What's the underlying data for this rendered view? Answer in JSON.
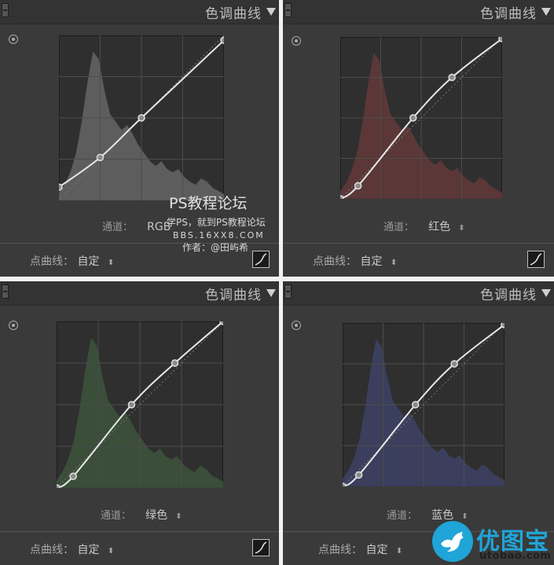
{
  "panels": [
    {
      "title": "色调曲线",
      "channel_label": "通道：",
      "channel": "RGB",
      "point_curve_label": "点曲线：",
      "point_curve_value": "自定",
      "hist_color": "#6e6e6e",
      "curve": [
        [
          0,
          0.08
        ],
        [
          0.25,
          0.26
        ],
        [
          0.5,
          0.5
        ],
        [
          1,
          0.97
        ]
      ]
    },
    {
      "title": "色调曲线",
      "channel_label": "通道：",
      "channel": "红色",
      "point_curve_label": "点曲线：",
      "point_curve_value": "自定",
      "hist_color": "#6b3b3b",
      "curve": [
        [
          0,
          0
        ],
        [
          0.11,
          0.08
        ],
        [
          0.45,
          0.5
        ],
        [
          0.69,
          0.75
        ],
        [
          1,
          0.99
        ]
      ]
    },
    {
      "title": "色调曲线",
      "channel_label": "通道：",
      "channel": "绿色",
      "point_curve_label": "点曲线：",
      "point_curve_value": "自定",
      "hist_color": "#3f5a3f",
      "curve": [
        [
          0,
          0
        ],
        [
          0.1,
          0.07
        ],
        [
          0.45,
          0.5
        ],
        [
          0.71,
          0.75
        ],
        [
          1,
          1
        ]
      ]
    },
    {
      "title": "色调曲线",
      "channel_label": "通道：",
      "channel": "蓝色",
      "point_curve_label": "点曲线：",
      "point_curve_value": "自定",
      "hist_color": "#40466e",
      "curve": [
        [
          0,
          0
        ],
        [
          0.1,
          0.07
        ],
        [
          0.45,
          0.5
        ],
        [
          0.69,
          0.75
        ],
        [
          1,
          0.99
        ]
      ]
    }
  ],
  "watermark": {
    "line1": "PS教程论坛",
    "line2": "学PS，就到PS教程论坛",
    "line3": "BBS.16XX8.COM",
    "line4": "作者：@田屿希"
  },
  "brand": {
    "name": "优图宝",
    "url": "utobao.com",
    "color": "#1fa5d8"
  }
}
